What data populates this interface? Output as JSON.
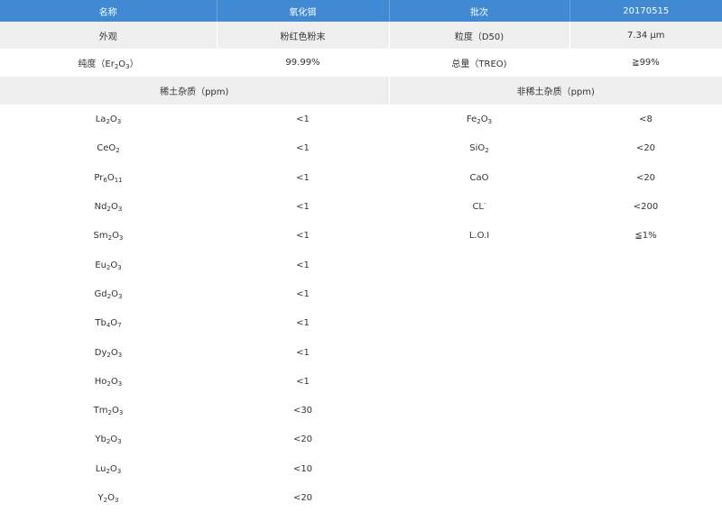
{
  "header": {
    "name_label": "名称",
    "name_value": "氧化铒",
    "batch_label": "批次",
    "batch_value": "20170515"
  },
  "summary": [
    {
      "label": "外观",
      "value": "粉红色粉末",
      "label2": "粒度（D50)",
      "value2": "7.34 μm"
    },
    {
      "label_pre": "纯度（Er",
      "label_s1": "2",
      "label_mid": "O",
      "label_s2": "3",
      "label_post": "）",
      "value": "99.99%",
      "label2": "总量（TREO)",
      "value2": "≧99%"
    }
  ],
  "sections": {
    "rare_earth": "稀土杂质（ppm)",
    "non_rare_earth": "非稀土杂质（ppm)"
  },
  "rare_earth": [
    {
      "a": "La",
      "b": "2",
      "c": "O",
      "d": "3",
      "value": "<1"
    },
    {
      "a": "CeO",
      "b": "2",
      "c": "",
      "d": "",
      "value": "<1"
    },
    {
      "a": "Pr",
      "b": "6",
      "c": "O",
      "d": "11",
      "value": "<1"
    },
    {
      "a": "Nd",
      "b": "2",
      "c": "O",
      "d": "3",
      "value": "<1"
    },
    {
      "a": "Sm",
      "b": "2",
      "c": "O",
      "d": "3",
      "value": "<1"
    },
    {
      "a": "Eu",
      "b": "2",
      "c": "O",
      "d": "3",
      "value": "<1"
    },
    {
      "a": "Gd",
      "b": "2",
      "c": "O",
      "d": "3",
      "value": "<1"
    },
    {
      "a": "Tb",
      "b": "4",
      "c": "O",
      "d": "7",
      "value": "<1"
    },
    {
      "a": "Dy",
      "b": "2",
      "c": "O",
      "d": "3",
      "value": "<1"
    },
    {
      "a": "Ho",
      "b": "2",
      "c": "O",
      "d": "3",
      "value": "<1"
    },
    {
      "a": "Tm",
      "b": "2",
      "c": "O",
      "d": "3",
      "value": "<30"
    },
    {
      "a": "Yb",
      "b": "2",
      "c": "O",
      "d": "3",
      "value": "<20"
    },
    {
      "a": "Lu",
      "b": "2",
      "c": "O",
      "d": "3",
      "value": "<10"
    },
    {
      "a": "Y",
      "b": "2",
      "c": "O",
      "d": "3",
      "value": "<20"
    }
  ],
  "non_rare_earth": [
    {
      "a": "Fe",
      "b": "2",
      "c": "O",
      "d": "3",
      "value": "<8"
    },
    {
      "a": "SiO",
      "b": "2",
      "c": "",
      "d": "",
      "value": "<20"
    },
    {
      "a": "CaO",
      "b": "",
      "c": "",
      "d": "",
      "value": "<20"
    },
    {
      "a": "CL",
      "sup": "-",
      "value": "<200"
    },
    {
      "a": "L.O.I",
      "b": "",
      "c": "",
      "d": "",
      "value": "≦1%"
    }
  ]
}
